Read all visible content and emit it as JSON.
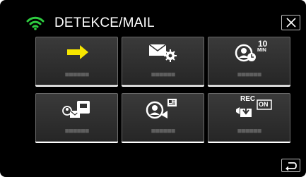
{
  "header": {
    "title": "DETEKCE/MAIL",
    "wifi_icon": "wifi-icon",
    "close_icon": "close-icon"
  },
  "tiles": [
    {
      "label": "■■■■■■",
      "icon": "arrow-right-icon",
      "accent": "#f7e600"
    },
    {
      "label": "■■■■■■",
      "icon": "mail-settings-icon",
      "accent": "#ffffff"
    },
    {
      "label": "■■■■■■",
      "icon": "person-timer-10min-icon",
      "badge": "10",
      "sub_badge": "MIN"
    },
    {
      "label": "■■■■■■",
      "icon": "mail-to-device-icon",
      "accent": "#ffffff"
    },
    {
      "label": "■■■■■■",
      "icon": "face-detect-icon",
      "accent": "#ffffff"
    },
    {
      "label": "■■■■■■",
      "icon": "rec-download-on-icon",
      "badge": "REC",
      "sub_badge": "ON"
    }
  ],
  "footer": {
    "back_icon": "return-icon"
  },
  "colors": {
    "background": "#000000",
    "tile": "#333333",
    "wifi": "#2ecc40",
    "arrow": "#f7e600"
  }
}
